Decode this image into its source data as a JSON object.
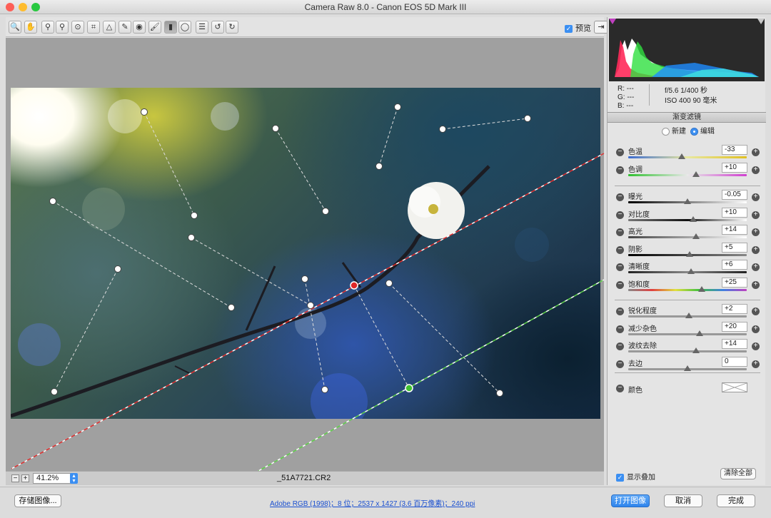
{
  "window": {
    "title": "Camera Raw 8.0 -  Canon EOS 5D Mark III"
  },
  "toolbar": {
    "tools": [
      {
        "name": "zoom-tool",
        "glyph": "🔍"
      },
      {
        "name": "hand-tool",
        "glyph": "✋"
      },
      {
        "name": "white-balance-tool",
        "glyph": "⚲"
      },
      {
        "name": "color-sampler-tool",
        "glyph": "⚲"
      },
      {
        "name": "targeted-adjustment-tool",
        "glyph": "⊙"
      },
      {
        "name": "crop-tool",
        "glyph": "⌗"
      },
      {
        "name": "straighten-tool",
        "glyph": "△"
      },
      {
        "name": "spot-removal-tool",
        "glyph": "✎"
      },
      {
        "name": "red-eye-tool",
        "glyph": "◉"
      },
      {
        "name": "adjustment-brush-tool",
        "glyph": "🖌"
      },
      {
        "name": "graduated-filter-tool",
        "glyph": "▮"
      },
      {
        "name": "radial-filter-tool",
        "glyph": "◯"
      },
      {
        "name": "preferences-tool",
        "glyph": "☰"
      },
      {
        "name": "rotate-left-tool",
        "glyph": "↺"
      },
      {
        "name": "rotate-right-tool",
        "glyph": "↻"
      }
    ],
    "preview_label": "预览"
  },
  "image": {
    "filename": "_51A7721.CR2",
    "zoom": "41.2%"
  },
  "info": {
    "r": "R:  ---",
    "g": "G:  ---",
    "b": "B:  ---",
    "aperture_shutter": "f/5.6   1/400 秒",
    "iso_focal": "ISO 400    90 毫米"
  },
  "panel": {
    "title": "渐变滤镜",
    "mode_new": "新建",
    "mode_edit": "编辑",
    "group1": [
      {
        "label": "色温",
        "value": "-33",
        "pos": 0.45
      },
      {
        "label": "色调",
        "value": "+10",
        "pos": 0.57
      }
    ],
    "group2": [
      {
        "label": "曝光",
        "value": "-0.05",
        "pos": 0.5
      },
      {
        "label": "对比度",
        "value": "+10",
        "pos": 0.55
      },
      {
        "label": "高光",
        "value": "+14",
        "pos": 0.57
      },
      {
        "label": "阴影",
        "value": "+5",
        "pos": 0.52
      },
      {
        "label": "清晰度",
        "value": "+6",
        "pos": 0.53
      },
      {
        "label": "饱和度",
        "value": "+25",
        "pos": 0.62
      }
    ],
    "group3": [
      {
        "label": "锐化程度",
        "value": "+2",
        "pos": 0.51
      },
      {
        "label": "减少杂色",
        "value": "+20",
        "pos": 0.6
      },
      {
        "label": "波纹去除",
        "value": "+14",
        "pos": 0.57
      },
      {
        "label": "去边",
        "value": "0",
        "pos": 0.5
      }
    ],
    "color_label": "颜色",
    "show_overlay": "显示叠加",
    "clear_all": "清除全部"
  },
  "footer": {
    "save_button": "存储图像...",
    "workflow_link": "Adobe RGB (1998)；8 位；2537 x 1427 (3.6 百万像素)；240 ppi",
    "open_button": "打开图像",
    "cancel_button": "取消",
    "done_button": "完成"
  }
}
